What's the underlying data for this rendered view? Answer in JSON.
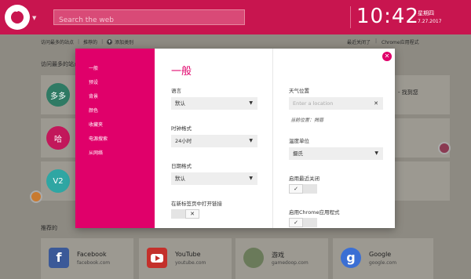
{
  "header": {
    "search_placeholder": "Search the web",
    "time": "10:42",
    "day": "星期四",
    "date": "7.27.2017"
  },
  "navbar": {
    "left": [
      "访问最多的站点",
      "推荐的",
      "添加类别"
    ],
    "right": [
      "最近关闭了",
      "Chrome应用程式"
    ]
  },
  "sections": {
    "most_visited": "访问最多的站点",
    "recommended": "推荐的"
  },
  "tiles": [
    {
      "label": "多多",
      "color": "#2f7a64"
    },
    {
      "label": "哈",
      "color": "#c2185b"
    },
    {
      "label": "V2",
      "color": "#2fa6a3"
    }
  ],
  "tile_right_text": "- 找到您",
  "recommended": [
    {
      "title": "Facebook",
      "sub": "facebook.com",
      "icon": "facebook-icon",
      "color": "#3b5998"
    },
    {
      "title": "YouTube",
      "sub": "youtube.com",
      "icon": "youtube-icon",
      "color": "#c4302b"
    },
    {
      "title": "游戏",
      "sub": "gamedoop.com",
      "icon": "games-icon",
      "color": "#6a7a5a"
    },
    {
      "title": "Google",
      "sub": "google.com",
      "icon": "google-icon",
      "color": "#3b6fd4"
    }
  ],
  "modal": {
    "menu": [
      "一般",
      "预设",
      "背景",
      "颜色",
      "收藏夹",
      "电源搜索",
      "从网络"
    ],
    "title": "一般",
    "language": {
      "label": "语言",
      "value": "默认"
    },
    "clock_format": {
      "label": "时钟格式",
      "value": "24小时"
    },
    "date_format": {
      "label": "日期格式",
      "value": "默认"
    },
    "open_links": {
      "label": "在新标签页中打开链接"
    },
    "weather": {
      "label": "天气位置",
      "placeholder": "Enter a location",
      "current": "当前位置：揭眉"
    },
    "temp_unit": {
      "label": "温度单位",
      "value": "摄氏"
    },
    "recent_closed": {
      "label": "启用最近关闭"
    },
    "chrome_apps": {
      "label": "启用Chrome应用程式"
    }
  },
  "colors": {
    "accent": "#e0006a",
    "topbar": "#c8154f",
    "background": "#8d8a82"
  }
}
